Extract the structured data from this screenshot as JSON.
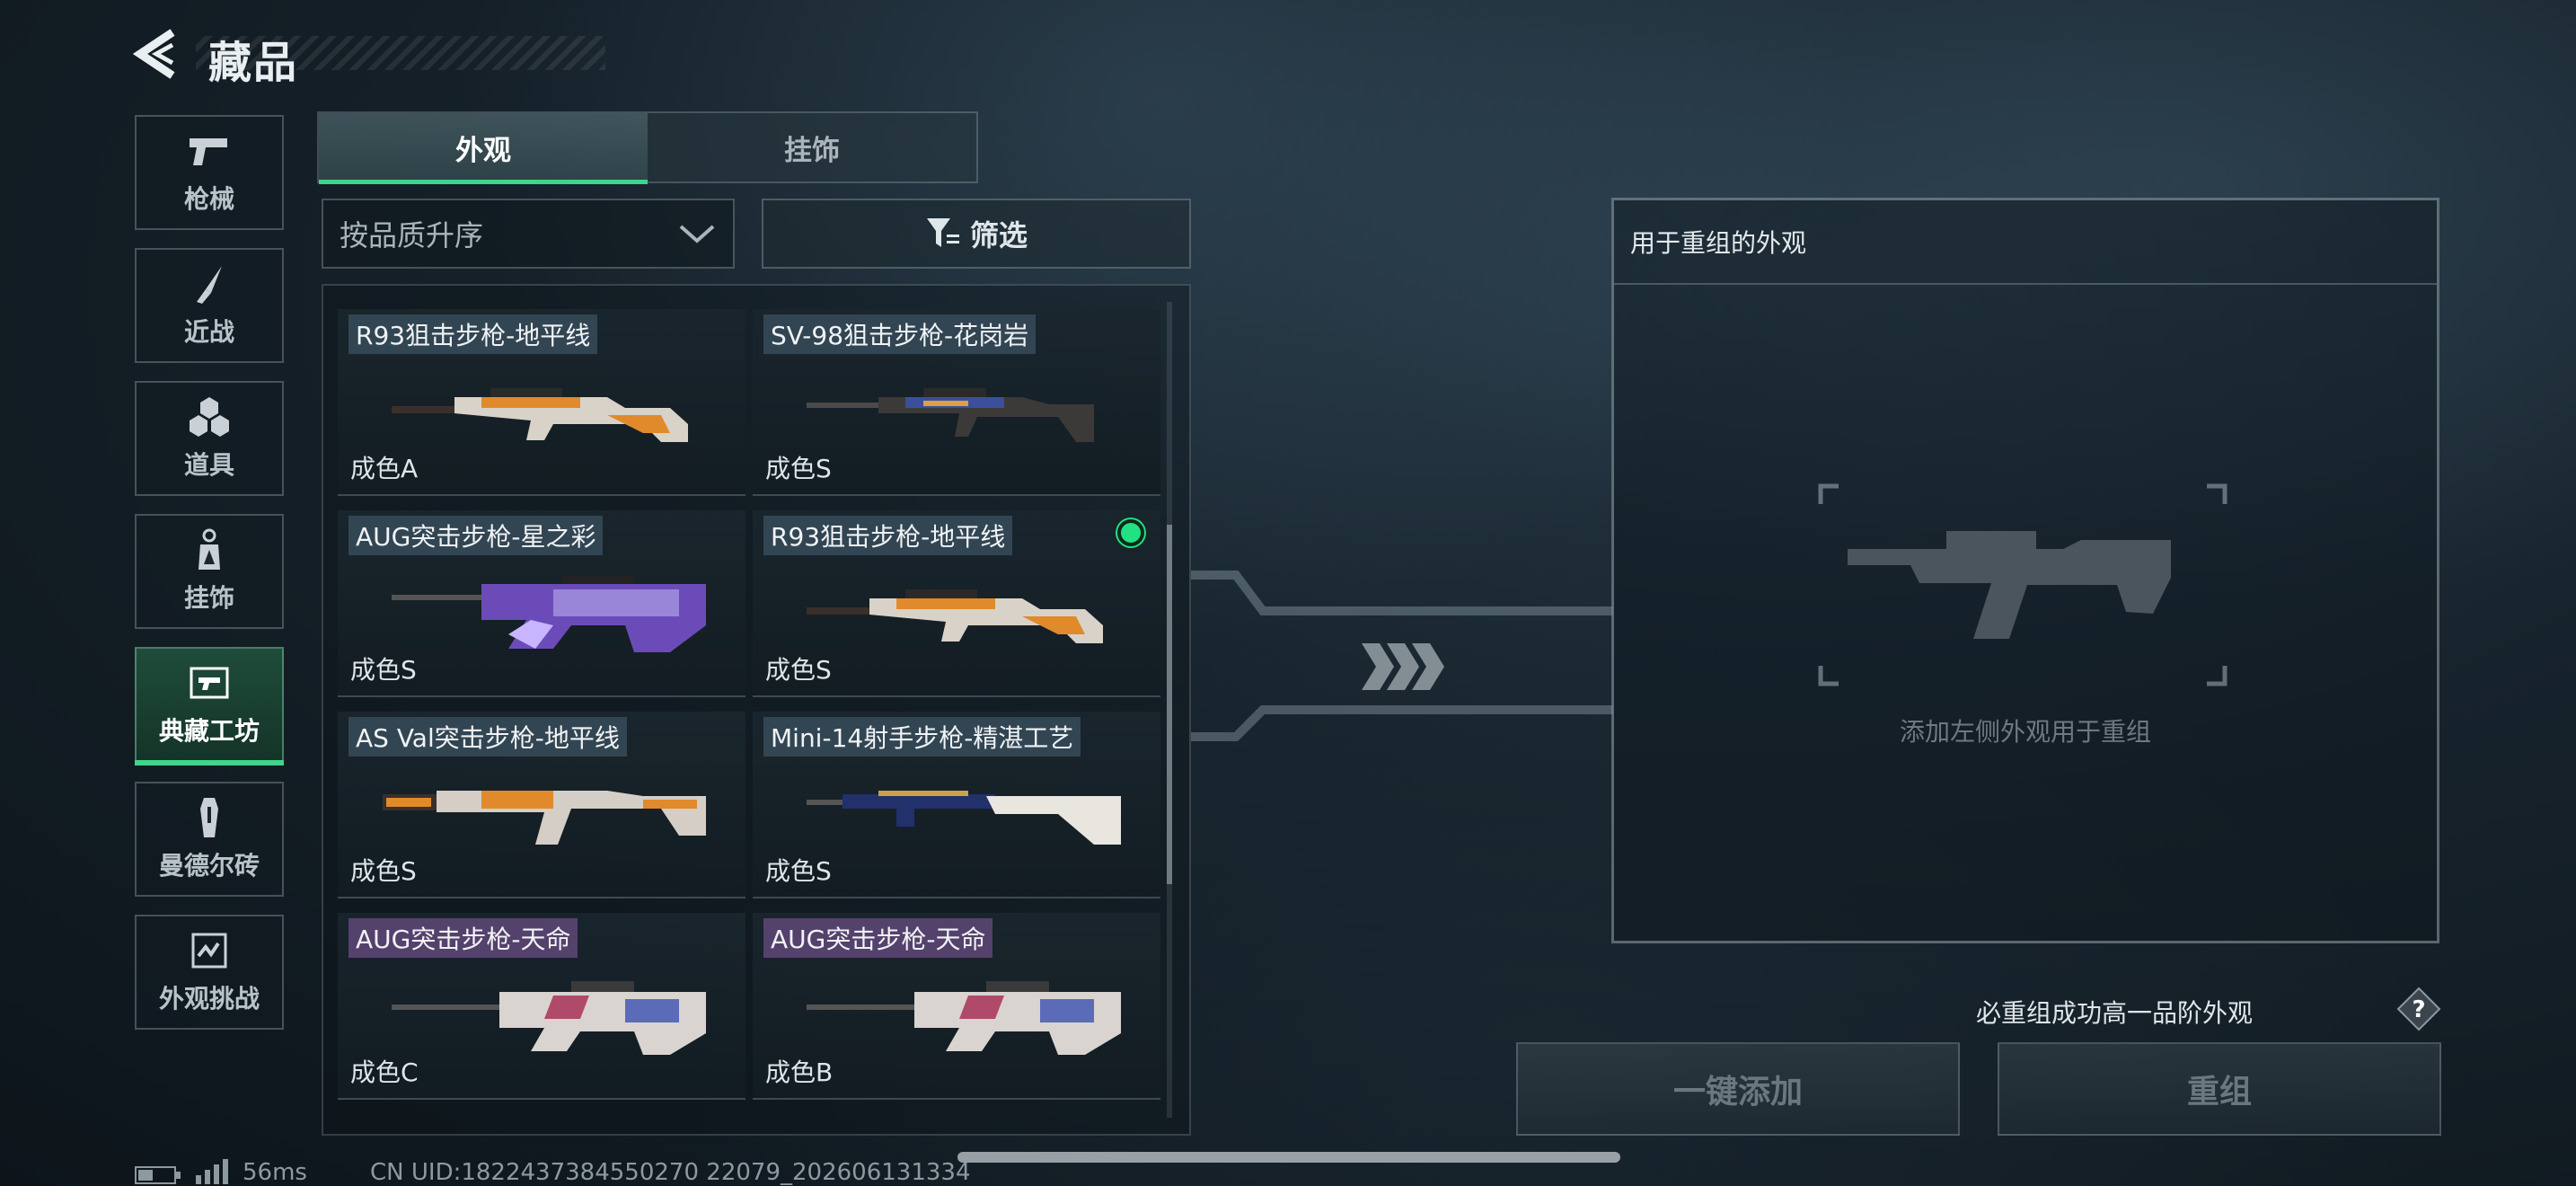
{
  "header": {
    "title": "藏品"
  },
  "sidebar": {
    "items": [
      {
        "label": "枪械",
        "icon": "pistol-icon"
      },
      {
        "label": "近战",
        "icon": "knife-icon"
      },
      {
        "label": "道具",
        "icon": "cubes-icon"
      },
      {
        "label": "挂饰",
        "icon": "charm-icon"
      },
      {
        "label": "典藏工坊",
        "icon": "workshop-icon",
        "active": true
      },
      {
        "label": "曼德尔砖",
        "icon": "brick-icon"
      },
      {
        "label": "外观挑战",
        "icon": "challenge-icon"
      }
    ]
  },
  "tabs": [
    {
      "label": "外观",
      "active": true
    },
    {
      "label": "挂饰",
      "active": false
    }
  ],
  "sort": {
    "label": "按品质升序"
  },
  "filter": {
    "label": "筛选"
  },
  "items": [
    {
      "name": "R93狙击步枪-地平线",
      "quality": "成色A",
      "skin": "horizon",
      "equipped": false
    },
    {
      "name": "SV-98狙击步枪-花岗岩",
      "quality": "成色S",
      "skin": "granite",
      "equipped": false
    },
    {
      "name": "AUG突击步枪-星之彩",
      "quality": "成色S",
      "skin": "starcolor",
      "equipped": false
    },
    {
      "name": "R93狙击步枪-地平线",
      "quality": "成色S",
      "skin": "horizon",
      "equipped": true
    },
    {
      "name": "AS Val突击步枪-地平线",
      "quality": "成色S",
      "skin": "horizon",
      "equipped": false
    },
    {
      "name": "Mini-14射手步枪-精湛工艺",
      "quality": "成色S",
      "skin": "craft",
      "equipped": false
    },
    {
      "name": "AUG突击步枪-天命",
      "quality": "成色C",
      "skin": "destiny",
      "equipped": false
    },
    {
      "name": "AUG突击步枪-天命",
      "quality": "成色B",
      "skin": "destiny",
      "equipped": false
    }
  ],
  "recombine": {
    "title": "用于重组的外观",
    "hint": "添加左侧外观用于重组",
    "guarantee": "必重组成功高一品阶外观"
  },
  "buttons": {
    "add_all": "一键添加",
    "recombine": "重组"
  },
  "status": {
    "ping": "56ms",
    "uid": "CN UID:1822437384550270 22079_202606131334"
  },
  "colors": {
    "accent": "#3ed68a",
    "equipped": "#23e083"
  }
}
